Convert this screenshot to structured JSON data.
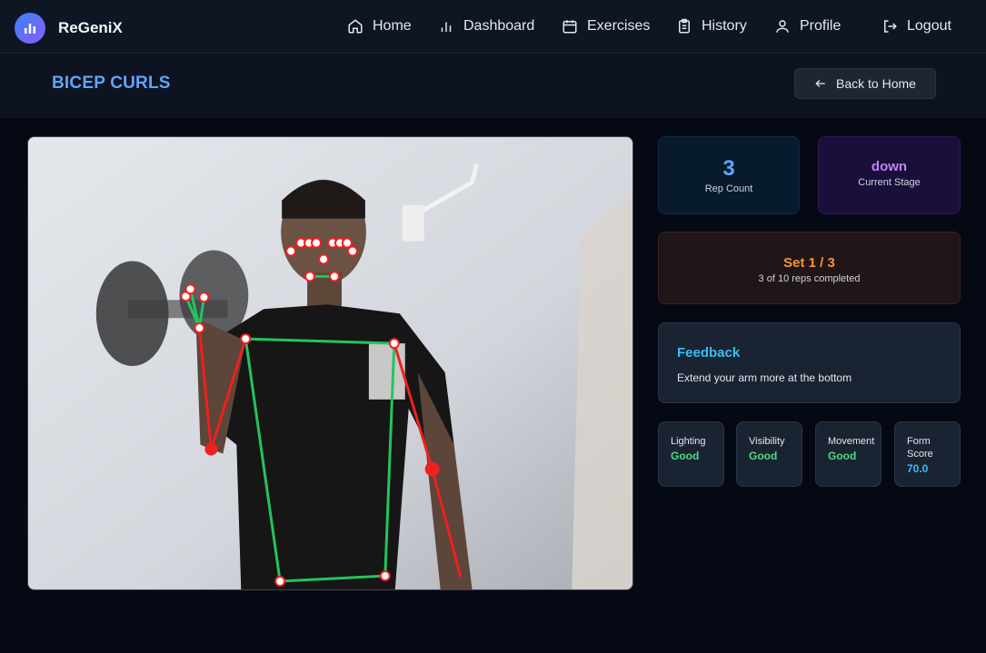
{
  "brand": {
    "name": "ReGeniX",
    "logo_icon": "bar-chart-icon"
  },
  "nav": {
    "items": [
      {
        "label": "Home",
        "icon": "home-icon"
      },
      {
        "label": "Dashboard",
        "icon": "bar-chart-icon"
      },
      {
        "label": "Exercises",
        "icon": "calendar-icon"
      },
      {
        "label": "History",
        "icon": "clipboard-icon"
      },
      {
        "label": "Profile",
        "icon": "user-icon"
      },
      {
        "label": "Logout",
        "icon": "logout-icon"
      }
    ]
  },
  "page": {
    "title": "BICEP CURLS",
    "back_label": "Back to Home"
  },
  "stats": {
    "rep_count": {
      "value": "3",
      "label": "Rep Count"
    },
    "stage": {
      "value": "down",
      "label": "Current Stage"
    },
    "set": {
      "value": "Set 1 / 3",
      "sub": "3 of 10 reps completed"
    }
  },
  "feedback": {
    "title": "Feedback",
    "text": "Extend your arm more at the bottom"
  },
  "metrics": [
    {
      "label": "Lighting",
      "value": "Good"
    },
    {
      "label": "Visibility",
      "value": "Good"
    },
    {
      "label": "Movement",
      "value": "Good"
    },
    {
      "label": "Form Score",
      "value": "70.0"
    }
  ],
  "colors": {
    "accent_blue": "#60a5fa",
    "stage_purple": "#c084fc",
    "set_orange": "#fb923c",
    "good_green": "#4ade80",
    "skeleton_green": "#22c55e",
    "skeleton_red": "#ef2020"
  }
}
